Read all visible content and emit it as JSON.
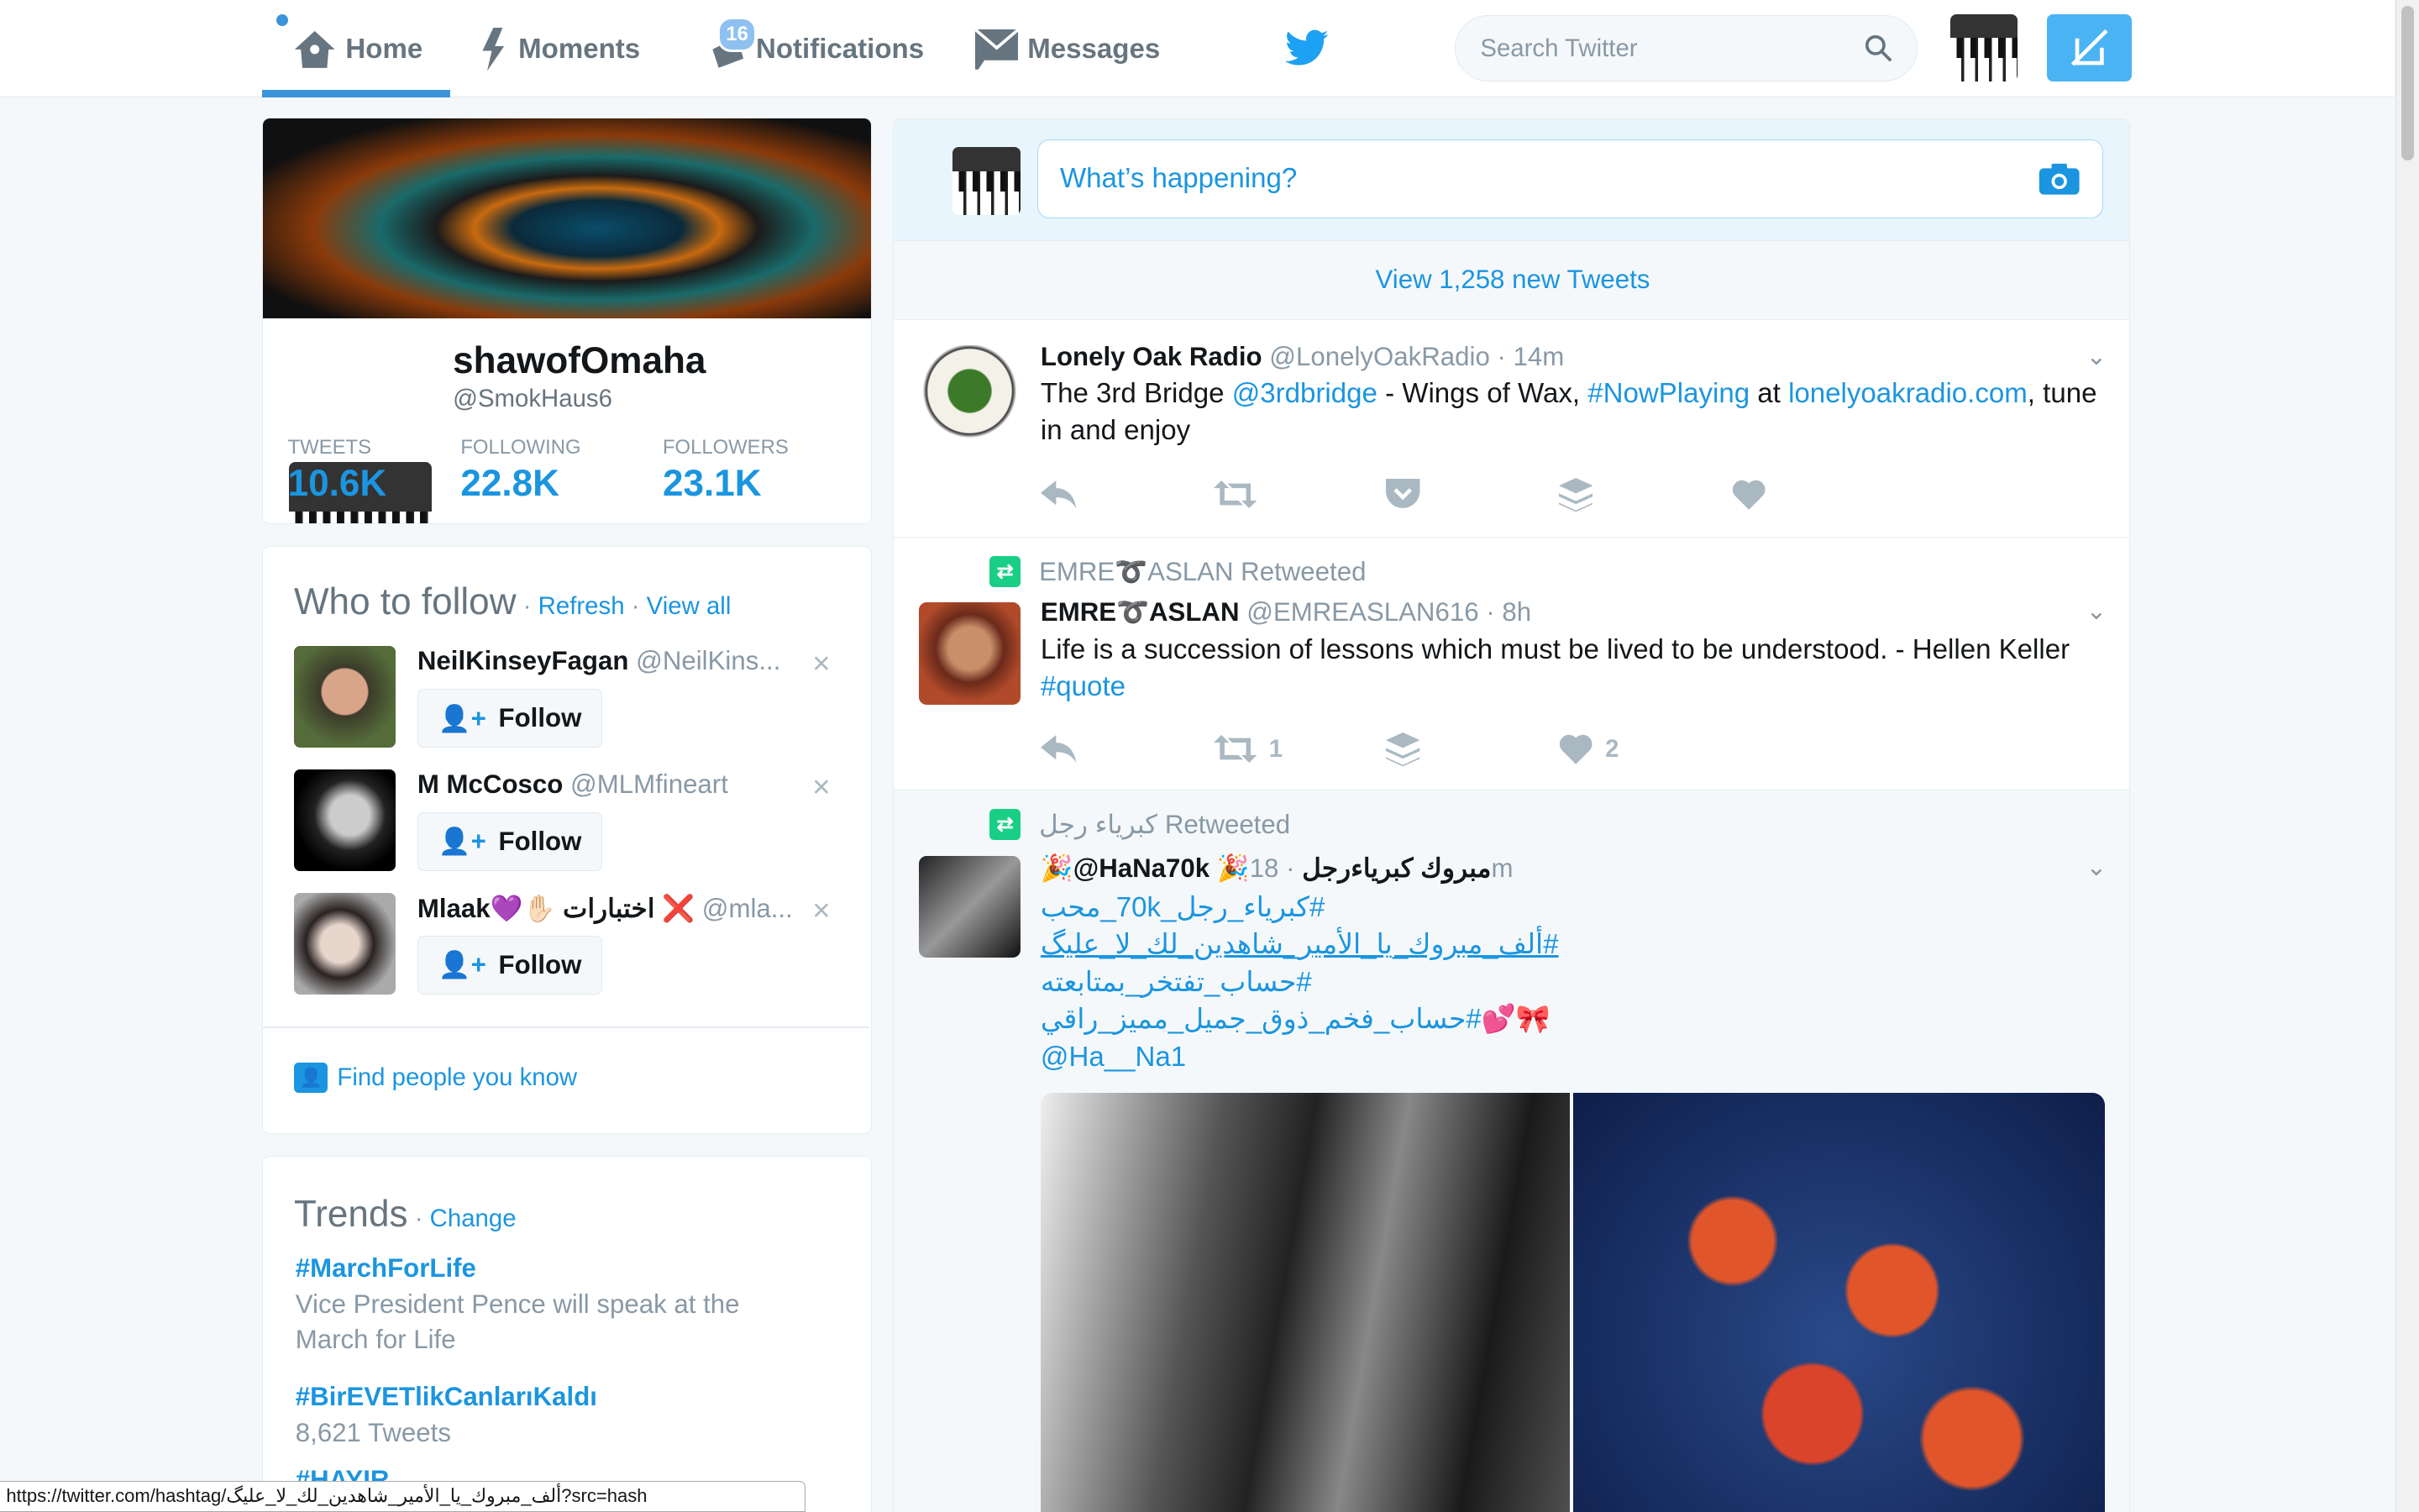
{
  "nav": {
    "home": "Home",
    "moments": "Moments",
    "notifications": "Notifications",
    "notif_count": "16",
    "messages": "Messages",
    "search_placeholder": "Search Twitter"
  },
  "profile": {
    "name": "shawofOmaha",
    "handle": "@SmokHaus6",
    "stats": [
      {
        "label": "TWEETS",
        "value": "10.6K"
      },
      {
        "label": "FOLLOWING",
        "value": "22.8K"
      },
      {
        "label": "FOLLOWERS",
        "value": "23.1K"
      }
    ]
  },
  "wtf": {
    "title": "Who to follow",
    "refresh": "Refresh",
    "view_all": "View all",
    "follow_label": "Follow",
    "find": "Find people you know",
    "users": [
      {
        "name": "NeilKinseyFagan",
        "handle": "@NeilKins..."
      },
      {
        "name": "M McCosco",
        "handle": "@MLMfineart"
      },
      {
        "name": "Mlaak💜✋🏻 اختبارات ❌",
        "handle": "@mla..."
      }
    ]
  },
  "trends": {
    "title": "Trends",
    "change": "Change",
    "items": [
      {
        "tag": "#MarchForLife",
        "desc": "Vice President Pence will speak at the March for Life"
      },
      {
        "tag": "#BirEVETlikCanlarıKaldı",
        "desc": "8,621 Tweets"
      },
      {
        "tag": "#HAYIR...",
        "desc": ""
      }
    ]
  },
  "compose": {
    "placeholder": "What’s happening?"
  },
  "new_tweets": "View 1,258 new Tweets",
  "tweets": [
    {
      "name": "Lonely Oak Radio",
      "handle": "@LonelyOakRadio",
      "time": "· 14m",
      "t1": "The 3rd Bridge ",
      "l1": "@3rdbridge",
      "t2": " - Wings of Wax, ",
      "l2": "#NowPlaying",
      "t3": " at ",
      "l3": "lonelyoakradio.com",
      "t4": ", tune in and enjoy"
    },
    {
      "retweeted_by": "EMRE➰ASLAN Retweeted",
      "name": "EMRE➰ASLAN",
      "handle": "@EMREASLAN616",
      "time": "· 8h",
      "t1": "Life is a succession of lessons which must be lived to be understood. - Hellen Keller ",
      "l1": "#quote",
      "retweets": "1",
      "likes": "2"
    },
    {
      "retweeted_by": "كبرياء رجل Retweeted",
      "name": "🎉@HaNa70k 🎉مبروك كبرياءرجل",
      "time": "· 18m",
      "lines": [
        "#كبرياء_رجل_70k_محب",
        "#ألف_مبروك_يا_الأمير_شاهدين_لك_لا_عليگ",
        "#حساب_تفتخر_بمتابعته",
        "🎀💕#حساب_فخم_ذوق_جميل_مميز_راقي",
        "@Ha__Na1"
      ]
    }
  ],
  "status_url": "https://twitter.com/hashtag/ألف_مبروك_يا_الأمير_شاهدين_لك_لا_عليگ?src=hash",
  "colors": {
    "accent": "#1b95e0",
    "retweet": "#19cf86"
  }
}
